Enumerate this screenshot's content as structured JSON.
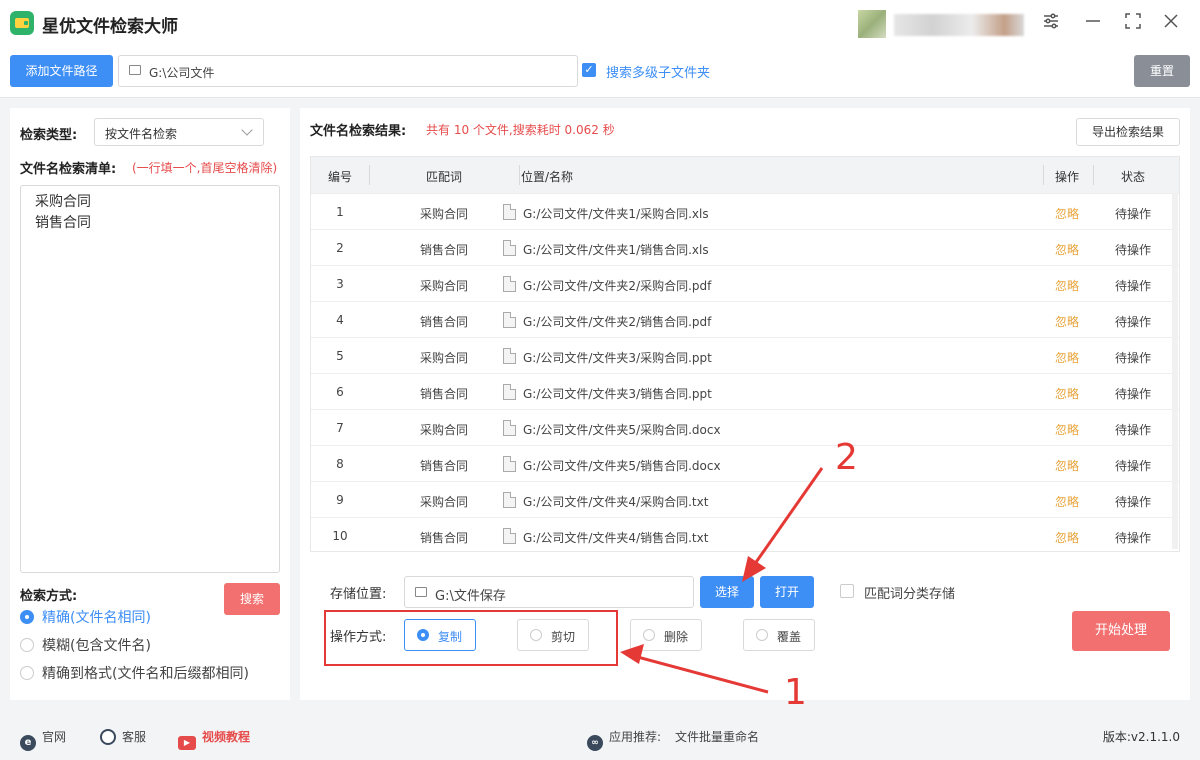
{
  "app": {
    "title": "星优文件检索大师"
  },
  "pathbar": {
    "add_path_label": "添加文件路径",
    "path_value": "G:\\公司文件",
    "subfolder_label": "搜索多级子文件夹",
    "subfolder_checked": true,
    "reset_label": "重置"
  },
  "left": {
    "search_type_label": "检索类型:",
    "search_type_value": "按文件名检索",
    "list_label": "文件名检索清单:",
    "list_hint": "(一行填一个,首尾空格清除)",
    "list_items": [
      "采购合同",
      "销售合同"
    ],
    "mode_label": "检索方式:",
    "search_button": "搜索",
    "modes": [
      {
        "label": "精确(文件名相同)",
        "selected": true
      },
      {
        "label": "模糊(包含文件名)",
        "selected": false
      },
      {
        "label": "精确到格式(文件名和后缀都相同)",
        "selected": false
      }
    ]
  },
  "results": {
    "label": "文件名检索结果:",
    "summary": "共有 10 个文件,搜索耗时 0.062 秒",
    "export_label": "导出检索结果",
    "columns": [
      "编号",
      "匹配词",
      "位置/名称",
      "操作",
      "状态"
    ],
    "rows": [
      {
        "num": "1",
        "word": "采购合同",
        "path": "G:/公司文件/文件夹1/采购合同.xls",
        "op": "忽略",
        "status": "待操作"
      },
      {
        "num": "2",
        "word": "销售合同",
        "path": "G:/公司文件/文件夹1/销售合同.xls",
        "op": "忽略",
        "status": "待操作"
      },
      {
        "num": "3",
        "word": "采购合同",
        "path": "G:/公司文件/文件夹2/采购合同.pdf",
        "op": "忽略",
        "status": "待操作"
      },
      {
        "num": "4",
        "word": "销售合同",
        "path": "G:/公司文件/文件夹2/销售合同.pdf",
        "op": "忽略",
        "status": "待操作"
      },
      {
        "num": "5",
        "word": "采购合同",
        "path": "G:/公司文件/文件夹3/采购合同.ppt",
        "op": "忽略",
        "status": "待操作"
      },
      {
        "num": "6",
        "word": "销售合同",
        "path": "G:/公司文件/文件夹3/销售合同.ppt",
        "op": "忽略",
        "status": "待操作"
      },
      {
        "num": "7",
        "word": "采购合同",
        "path": "G:/公司文件/文件夹5/采购合同.docx",
        "op": "忽略",
        "status": "待操作"
      },
      {
        "num": "8",
        "word": "销售合同",
        "path": "G:/公司文件/文件夹5/销售合同.docx",
        "op": "忽略",
        "status": "待操作"
      },
      {
        "num": "9",
        "word": "采购合同",
        "path": "G:/公司文件/文件夹4/采购合同.txt",
        "op": "忽略",
        "status": "待操作"
      },
      {
        "num": "10",
        "word": "销售合同",
        "path": "G:/公司文件/文件夹4/销售合同.txt",
        "op": "忽略",
        "status": "待操作"
      }
    ]
  },
  "storage": {
    "label": "存储位置:",
    "path_value": "G:\\文件保存",
    "select_label": "选择",
    "open_label": "打开",
    "classify_label": "匹配词分类存储",
    "classify_checked": false
  },
  "operation": {
    "label": "操作方式:",
    "options": [
      {
        "label": "复制",
        "selected": true
      },
      {
        "label": "剪切",
        "selected": false
      },
      {
        "label": "删除",
        "selected": false
      },
      {
        "label": "覆盖",
        "selected": false
      }
    ],
    "start_label": "开始处理"
  },
  "annotations": {
    "marker_1": "1",
    "marker_2": "2"
  },
  "footer": {
    "website": "官网",
    "support": "客服",
    "video": "视频教程",
    "recommend_label": "应用推荐:",
    "recommend_app": "文件批量重命名",
    "version": "版本:v2.1.1.0"
  },
  "colors": {
    "accent": "#3d8ef5",
    "danger": "#f37070",
    "ignore": "#e8a43a",
    "annotation": "#e53935"
  }
}
